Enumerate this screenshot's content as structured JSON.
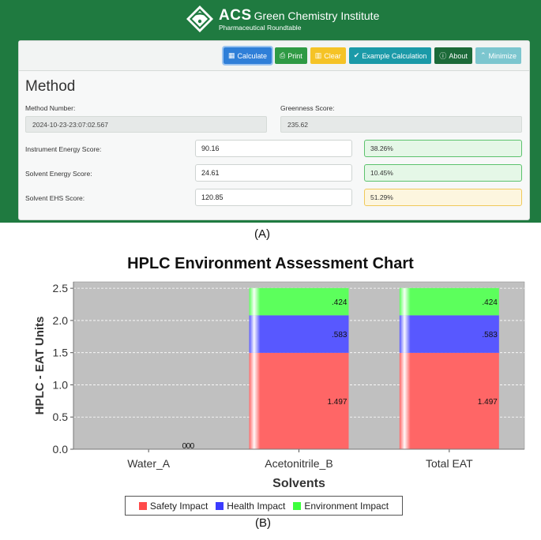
{
  "header": {
    "brand": "ACS",
    "institute": "Green Chemistry Institute",
    "subtitle": "Pharmaceutical Roundtable"
  },
  "toolbar": {
    "buttons": [
      {
        "label": "Calculate",
        "icon": "calculator-icon"
      },
      {
        "label": "Print",
        "icon": "print-icon"
      },
      {
        "label": "Clear",
        "icon": "trash-icon"
      },
      {
        "label": "Example Calculation",
        "icon": "check-icon"
      },
      {
        "label": "About",
        "icon": "info-icon"
      },
      {
        "label": "Minimize",
        "icon": "chevron-up-icon"
      }
    ]
  },
  "method": {
    "title": "Method",
    "method_number_label": "Method Number:",
    "method_number": "2024-10-23-23:07:02.567",
    "greenness_label": "Greenness Score:",
    "greenness_score": "235.62",
    "rows": [
      {
        "label": "Instrument Energy Score:",
        "value": "90.16",
        "percent": "38.26%",
        "status": "good"
      },
      {
        "label": "Solvent Energy Score:",
        "value": "24.61",
        "percent": "10.45%",
        "status": "good"
      },
      {
        "label": "Solvent EHS Score:",
        "value": "120.85",
        "percent": "51.29%",
        "status": "warn"
      }
    ]
  },
  "captions": {
    "a": "(A)",
    "b": "(B)"
  },
  "chart_data": {
    "type": "bar",
    "stacked": true,
    "title": "HPLC Environment Assessment Chart",
    "xlabel": "Solvents",
    "ylabel": "HPLC - EAT Units",
    "categories": [
      "Water_A",
      "Acetonitrile_B",
      "Total EAT"
    ],
    "series": [
      {
        "name": "Safety Impact",
        "values": [
          0,
          1.497,
          1.497
        ],
        "labels": [
          "0",
          "1.497",
          "1.497"
        ],
        "color": "#ff6666"
      },
      {
        "name": "Health Impact",
        "values": [
          0,
          0.583,
          0.583
        ],
        "labels": [
          "0",
          ".583",
          ".583"
        ],
        "color": "#5858ff"
      },
      {
        "name": "Environment Impact",
        "values": [
          0,
          0.424,
          0.424
        ],
        "labels": [
          "0",
          ".424",
          ".424"
        ],
        "color": "#5cff5c"
      }
    ],
    "yticks": [
      "0.0",
      "0.5",
      "1.0",
      "1.5",
      "2.0",
      "2.5"
    ],
    "ylim": [
      0,
      2.6
    ],
    "grid": true,
    "legend": "bottom",
    "plot_background": "#c0c0c0"
  }
}
